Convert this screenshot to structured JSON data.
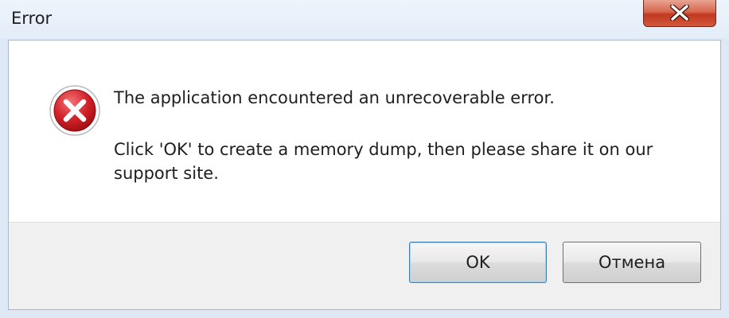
{
  "window": {
    "title": "Error",
    "close_icon": "close-icon"
  },
  "message": {
    "icon": "error-icon",
    "main": "The application encountered an unrecoverable error.",
    "detail": "Click 'OK' to create a memory dump, then please share it on our support site."
  },
  "buttons": {
    "ok_label": "OK",
    "cancel_label": "Отмена"
  },
  "colors": {
    "error_red": "#c8181e",
    "close_button": "#c9452b",
    "title_bar": "#e3edf8"
  }
}
